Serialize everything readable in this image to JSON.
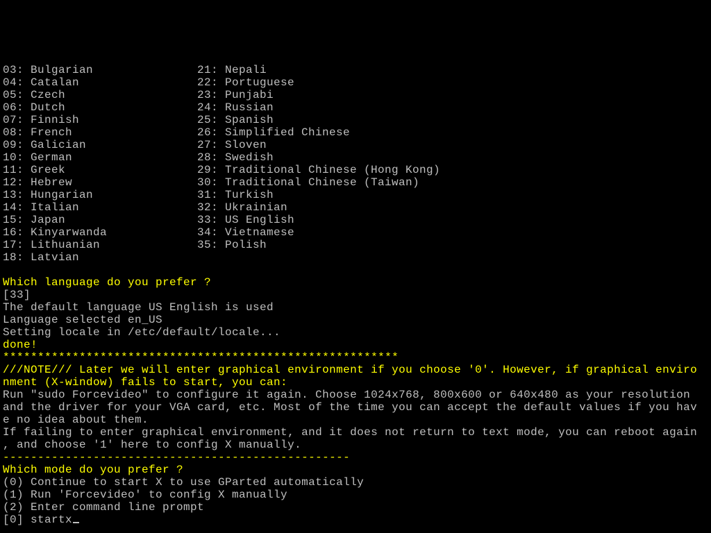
{
  "languages_col1": [
    "03: Bulgarian",
    "04: Catalan",
    "05: Czech",
    "06: Dutch",
    "07: Finnish",
    "08: French",
    "09: Galician",
    "10: German",
    "11: Greek",
    "12: Hebrew",
    "13: Hungarian",
    "14: Italian",
    "15: Japan",
    "16: Kinyarwanda",
    "17: Lithuanian",
    "18: Latvian"
  ],
  "languages_col2": [
    "21: Nepali",
    "22: Portuguese",
    "23: Punjabi",
    "24: Russian",
    "25: Spanish",
    "26: Simplified Chinese",
    "27: Sloven",
    "28: Swedish",
    "29: Traditional Chinese (Hong Kong)",
    "30: Traditional Chinese (Taiwan)",
    "31: Turkish",
    "32: Ukrainian",
    "33: US English",
    "34: Vietnamese",
    "35: Polish"
  ],
  "prompt_lang": "Which language do you prefer ?",
  "lang_input": "[33]",
  "lang_default": "The default language US English is used",
  "lang_selected": "Language selected en_US",
  "lang_setting": "Setting locale in /etc/default/locale...",
  "done": "done!",
  "stars": "*********************************************************",
  "note_l1": "///NOTE/// Later we will enter graphical environment if you choose '0'. However, if graphical enviro",
  "note_l2": "nment (X-window) fails to start, you can:",
  "help_l1": "Run \"sudo Forcevideo\" to configure it again. Choose 1024x768, 800x600 or 640x480 as your resolution ",
  "help_l2": "and the driver for your VGA card, etc. Most of the time you can accept the default values if you hav",
  "help_l3": "e no idea about them.",
  "help_l4": "If failing to enter graphical environment, and it does not return to text mode, you can reboot again",
  "help_l5": ", and choose '1' here to config X manually.",
  "dashes": "--------------------------------------------------",
  "prompt_mode": "Which mode do you prefer ?",
  "mode_0": "(0) Continue to start X to use GParted automatically",
  "mode_1": "(1) Run 'Forcevideo' to config X manually",
  "mode_2": "(2) Enter command line prompt",
  "mode_input": "[0] startx"
}
